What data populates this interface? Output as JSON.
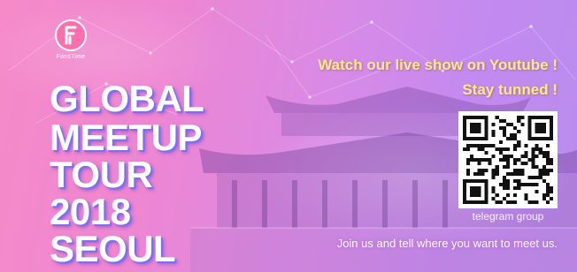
{
  "brand": {
    "logo_text": "FansTime"
  },
  "title": {
    "line1": "GLOBAL",
    "line2": "MEETUP",
    "line3": "TOUR",
    "line4": "2018",
    "line5": "SEOUL"
  },
  "headline": {
    "line1": "Watch our live show on Youtube !",
    "line2": "Stay tunned !"
  },
  "qr": {
    "caption": "telegram group"
  },
  "footer": {
    "text": "Join us and tell where you want to meet us."
  },
  "icons": {
    "logo": "fanstime-logo-icon",
    "qr": "qr-code-icon",
    "background": "palace-silhouette"
  },
  "colors": {
    "headline": "#ffeb7a",
    "title_shadow": "#7a6ff0",
    "bg_start": "#f68ac8",
    "bg_end": "#b98cee"
  }
}
